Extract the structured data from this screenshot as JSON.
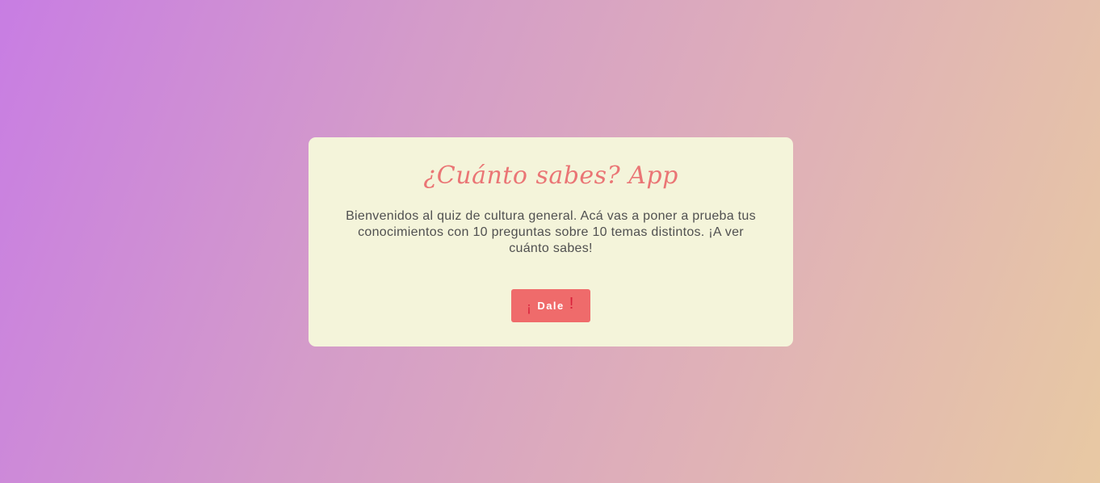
{
  "app": {
    "title": "¿Cuánto sabes? App"
  },
  "welcome": {
    "text": "Bienvenidos al quiz de cultura general. Acá vas a poner a prueba tus conocimientos con 10 preguntas sobre 10 temas distintos. ¡A ver cuánto sabes!"
  },
  "start_button": {
    "label": "Dale",
    "open_glyph": "¡",
    "close_glyph": "!"
  },
  "colors": {
    "card_background": "#f4f4da",
    "title": "#ea7575",
    "button": "#ef6b6b",
    "button_glyph": "#d8203a",
    "gradient_start": "#c87de3",
    "gradient_end": "#e8c9a3"
  }
}
